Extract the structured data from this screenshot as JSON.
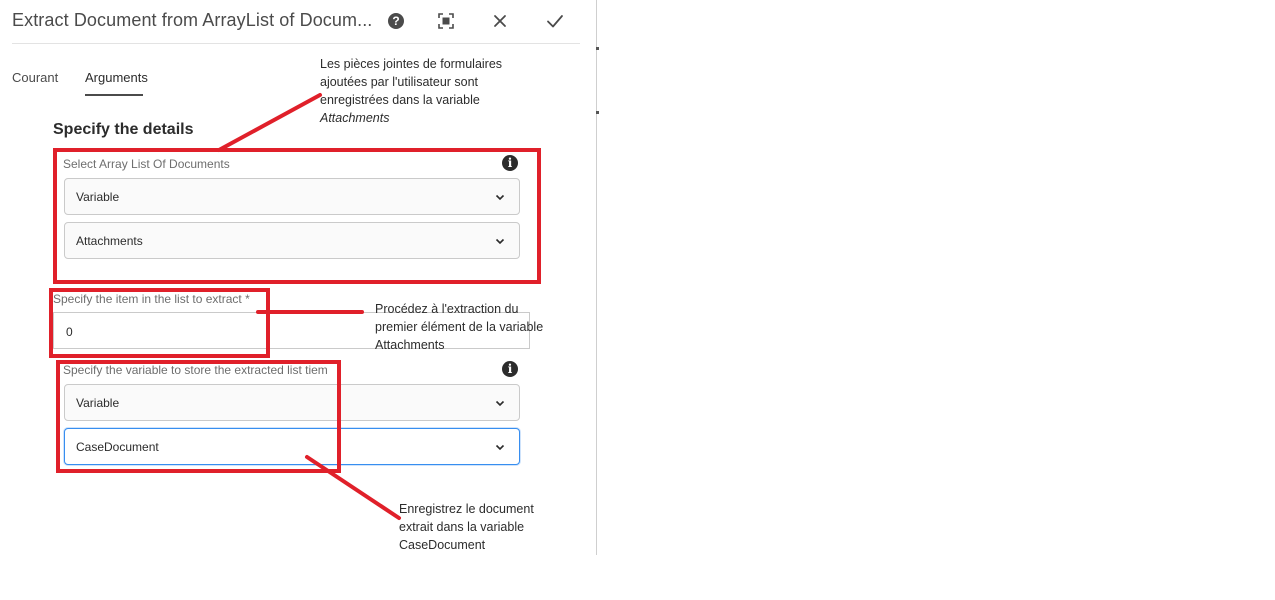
{
  "dialog": {
    "title": "Extract Document from ArrayList of Docum...",
    "icons": {
      "help": "help-icon",
      "fullscreen": "fullscreen-icon",
      "close": "close-icon",
      "confirm": "checkmark-icon"
    }
  },
  "tabs": [
    {
      "label": "Courant",
      "active": false
    },
    {
      "label": "Arguments",
      "active": true
    }
  ],
  "section": {
    "title": "Specify the details"
  },
  "fields": {
    "array_list": {
      "label": "Select Array List Of Documents",
      "mode_value": "Variable",
      "variable_value": "Attachments"
    },
    "item_index": {
      "label": "Specify the item in the list to extract *",
      "value": "0"
    },
    "store_variable": {
      "label": "Specify the variable to store the extracted list tiem",
      "mode_value": "Variable",
      "variable_value": "CaseDocument"
    }
  },
  "annotations": {
    "attachments_note": {
      "line1": "Les pièces jointes de formulaires",
      "line2": "ajoutées par l'utilisateur sont",
      "line3": "enregistrées dans la variable",
      "line4": "Attachments"
    },
    "extract_note": {
      "line1": "Procédez à l'extraction du",
      "line2": "premier élément de la variable",
      "line3": "Attachments"
    },
    "store_note": {
      "line1": "Enregistrez le document",
      "line2": "extrait dans la variable",
      "line3": "CaseDocument"
    }
  },
  "colors": {
    "annotation_red": "#e0202a",
    "focus_blue": "#378ef0",
    "text_dark": "#2c2c2c"
  }
}
